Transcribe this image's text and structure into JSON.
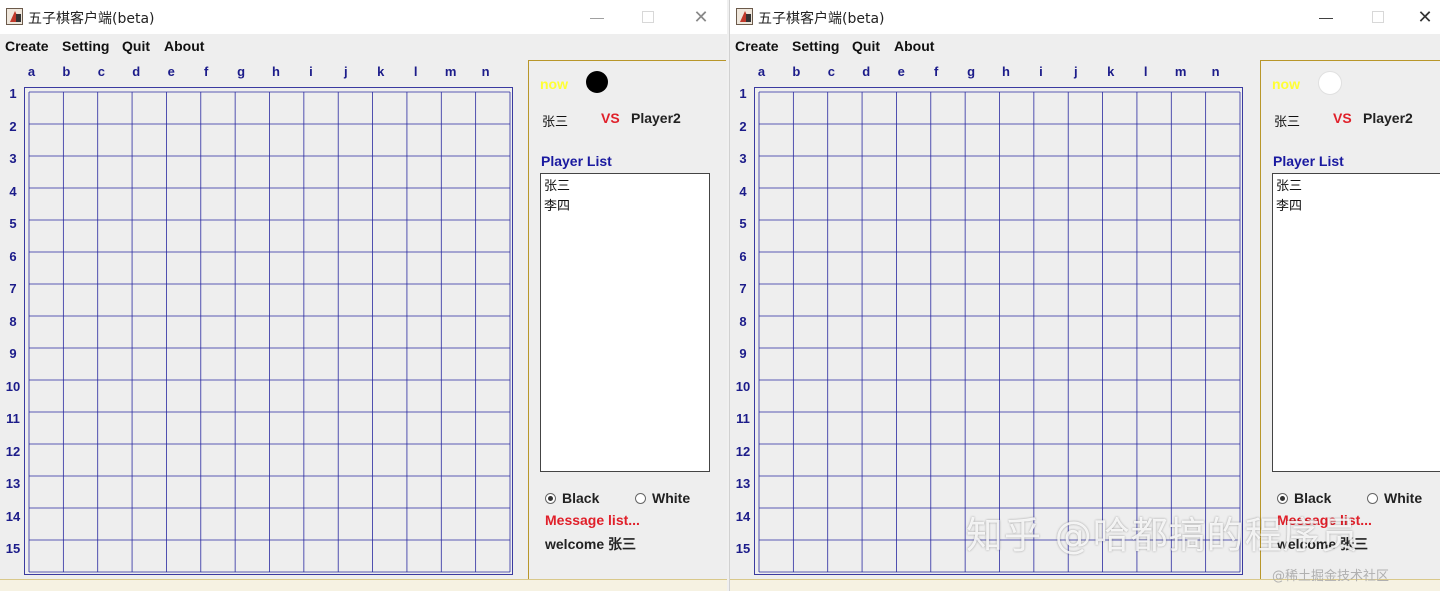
{
  "windows": [
    {
      "title": "五子棋客户端(beta)",
      "menu": [
        "Create",
        "Setting",
        "Quit",
        "About"
      ],
      "columns": [
        "a",
        "b",
        "c",
        "d",
        "e",
        "f",
        "g",
        "h",
        "i",
        "j",
        "k",
        "l",
        "m",
        "n"
      ],
      "rows": [
        "1",
        "2",
        "3",
        "4",
        "5",
        "6",
        "7",
        "8",
        "9",
        "10",
        "11",
        "12",
        "13",
        "14",
        "15"
      ],
      "now_label": "now",
      "now_stone": "black",
      "player1": "张三",
      "vs_label": "VS",
      "player2": "Player2",
      "player_list_title": "Player List",
      "player_list": [
        "张三",
        "李四"
      ],
      "radio_black": "Black",
      "radio_white": "White",
      "selected_color": "Black",
      "message_title": "Message list...",
      "message_text": "welcome 张三"
    },
    {
      "title": "五子棋客户端(beta)",
      "menu": [
        "Create",
        "Setting",
        "Quit",
        "About"
      ],
      "columns": [
        "a",
        "b",
        "c",
        "d",
        "e",
        "f",
        "g",
        "h",
        "i",
        "j",
        "k",
        "l",
        "m",
        "n"
      ],
      "rows": [
        "1",
        "2",
        "3",
        "4",
        "5",
        "6",
        "7",
        "8",
        "9",
        "10",
        "11",
        "12",
        "13",
        "14",
        "15"
      ],
      "now_label": "now",
      "now_stone": "white",
      "player1": "张三",
      "vs_label": "VS",
      "player2": "Player2",
      "player_list_title": "Player List",
      "player_list": [
        "张三",
        "李四"
      ],
      "radio_black": "Black",
      "radio_white": "White",
      "selected_color": "Black",
      "message_title": "Message list...",
      "message_text": "welcome 张三"
    }
  ],
  "window_controls": {
    "minimize": "—",
    "close": "✕"
  },
  "watermark": "知乎 @哈都搞的程序员",
  "watermark_small": "@稀土掘金技术社区",
  "colors": {
    "grid_line": "#2a2aa0",
    "label_blue": "#1c1c8a",
    "vs_red": "#e0202a",
    "now_yellow": "#ffff33",
    "panel_border": "#b8962a"
  }
}
